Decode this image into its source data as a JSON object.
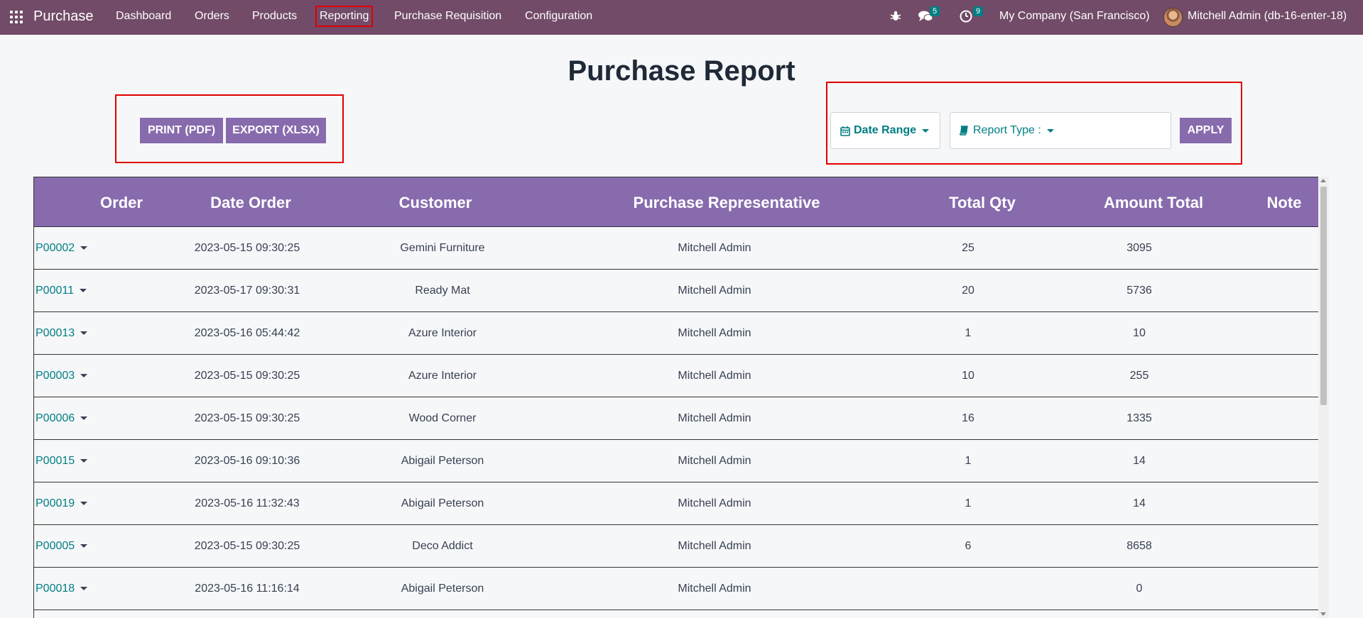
{
  "navbar": {
    "brand": "Purchase",
    "menu": [
      "Dashboard",
      "Orders",
      "Products",
      "Reporting",
      "Purchase Requisition",
      "Configuration"
    ],
    "active_menu": "Reporting",
    "messages_count": "5",
    "activities_count": "9",
    "company": "My Company (San Francisco)",
    "user": "Mitchell Admin (db-16-enter-18)"
  },
  "page": {
    "title": "Purchase Report",
    "print_label": "PRINT (PDF)",
    "export_label": "EXPORT (XLSX)",
    "date_range_label": "Date Range",
    "report_type_label": "Report Type :",
    "apply_label": "APPLY"
  },
  "table": {
    "headers": [
      "Order",
      "Date Order",
      "Customer",
      "Purchase Representative",
      "Total Qty",
      "Amount Total",
      "Note"
    ],
    "rows": [
      {
        "order": "P00002",
        "date": "2023-05-15 09:30:25",
        "customer": "Gemini Furniture",
        "rep": "Mitchell Admin",
        "qty": "25",
        "amount": "3095",
        "note": ""
      },
      {
        "order": "P00011",
        "date": "2023-05-17 09:30:31",
        "customer": "Ready Mat",
        "rep": "Mitchell Admin",
        "qty": "20",
        "amount": "5736",
        "note": ""
      },
      {
        "order": "P00013",
        "date": "2023-05-16 05:44:42",
        "customer": "Azure Interior",
        "rep": "Mitchell Admin",
        "qty": "1",
        "amount": "10",
        "note": ""
      },
      {
        "order": "P00003",
        "date": "2023-05-15 09:30:25",
        "customer": "Azure Interior",
        "rep": "Mitchell Admin",
        "qty": "10",
        "amount": "255",
        "note": ""
      },
      {
        "order": "P00006",
        "date": "2023-05-15 09:30:25",
        "customer": "Wood Corner",
        "rep": "Mitchell Admin",
        "qty": "16",
        "amount": "1335",
        "note": ""
      },
      {
        "order": "P00015",
        "date": "2023-05-16 09:10:36",
        "customer": "Abigail Peterson",
        "rep": "Mitchell Admin",
        "qty": "1",
        "amount": "14",
        "note": ""
      },
      {
        "order": "P00019",
        "date": "2023-05-16 11:32:43",
        "customer": "Abigail Peterson",
        "rep": "Mitchell Admin",
        "qty": "1",
        "amount": "14",
        "note": ""
      },
      {
        "order": "P00005",
        "date": "2023-05-15 09:30:25",
        "customer": "Deco Addict",
        "rep": "Mitchell Admin",
        "qty": "6",
        "amount": "8658",
        "note": ""
      },
      {
        "order": "P00018",
        "date": "2023-05-16 11:16:14",
        "customer": "Abigail Peterson",
        "rep": "Mitchell Admin",
        "qty": "",
        "amount": "0",
        "note": ""
      }
    ]
  },
  "colors": {
    "navbar": "#714b67",
    "accent": "#876bad",
    "link": "#017e84",
    "highlight": "#e00000"
  }
}
